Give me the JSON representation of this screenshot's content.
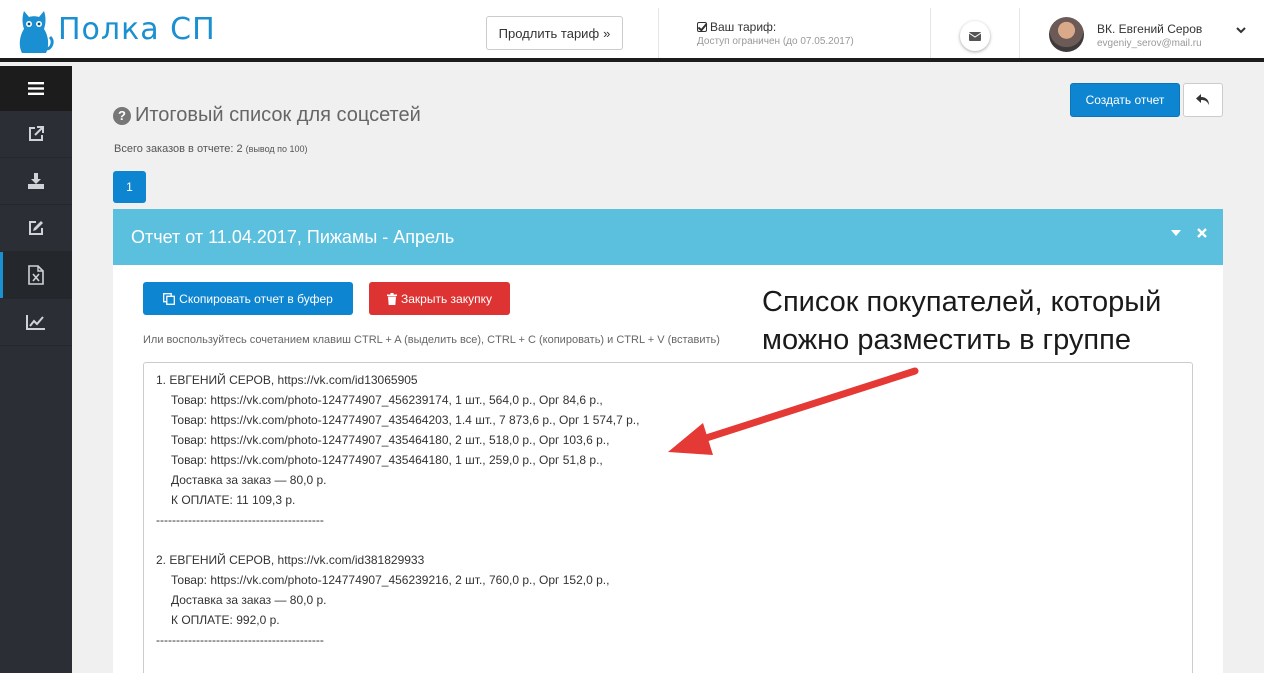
{
  "header": {
    "logo_text": "Полка СП",
    "extend_button": "Продлить тариф",
    "tariff_title": "Ваш тариф:",
    "tariff_status": "Доступ ограничен (до 07.05.2017)",
    "user_name": "ВК. Евгений Серов",
    "user_email": "evgeniy_serov@mail.ru"
  },
  "sidebar": {
    "items": [
      {
        "icon": "external-link-icon"
      },
      {
        "icon": "download-icon"
      },
      {
        "icon": "edit-icon"
      },
      {
        "icon": "excel-file-icon",
        "active": true
      },
      {
        "icon": "chart-line-icon"
      }
    ]
  },
  "main": {
    "title": "Итоговый список для соцсетей",
    "total_text": "Всего заказов в отчете: 2",
    "total_small": "(вывод по 100)",
    "create_button": "Создать отчет",
    "page": "1"
  },
  "panel": {
    "title": "Отчет от 11.04.2017, Пижамы - Апрель",
    "copy_button": "Скопировать отчет в буфер",
    "close_button": "Закрыть закупку",
    "hint": "Или воспользуйтесь сочетанием клавиш CTRL + A (выделить все), CTRL + C (копировать) и CTRL + V (вставить)",
    "lines": [
      {
        "text": "1. ЕВГЕНИЙ СЕРОВ, https://vk.com/id13065905",
        "indent": false
      },
      {
        "text": "Товар: https://vk.com/photo-124774907_456239174, 1 шт., 564,0 р., Орг 84,6 р.,",
        "indent": true
      },
      {
        "text": "Товар: https://vk.com/photo-124774907_435464203, 1.4 шт., 7 873,6 р., Орг 1 574,7 р.,",
        "indent": true
      },
      {
        "text": "Товар: https://vk.com/photo-124774907_435464180, 2 шт., 518,0 р., Орг 103,6 р.,",
        "indent": true
      },
      {
        "text": "Товар: https://vk.com/photo-124774907_435464180, 1 шт., 259,0 р., Орг 51,8 р.,",
        "indent": true
      },
      {
        "text": "Доставка за заказ — 80,0 р.",
        "indent": true
      },
      {
        "text": "К ОПЛАТЕ: 11 109,3 р.",
        "indent": true
      },
      {
        "text": "------------------------------------------",
        "indent": false
      },
      {
        "text": "",
        "indent": false
      },
      {
        "text": "2. ЕВГЕНИЙ СЕРОВ, https://vk.com/id381829933",
        "indent": false
      },
      {
        "text": "Товар: https://vk.com/photo-124774907_456239216, 2 шт., 760,0 р., Орг 152,0 р.,",
        "indent": true
      },
      {
        "text": "Доставка за заказ — 80,0 р.",
        "indent": true
      },
      {
        "text": "К ОПЛАТЕ: 992,0 р.",
        "indent": true
      },
      {
        "text": "------------------------------------------",
        "indent": false
      }
    ]
  },
  "annotation": {
    "line1": "Список покупателей, который",
    "line2": "можно разместить в группе",
    "color": "#e53935"
  },
  "colors": {
    "brand": "#1a8fd1",
    "primary_button": "#0e85d1",
    "danger_button": "#dd3333",
    "panel_header": "#5bc0de",
    "sidebar": "#2b2f35"
  }
}
